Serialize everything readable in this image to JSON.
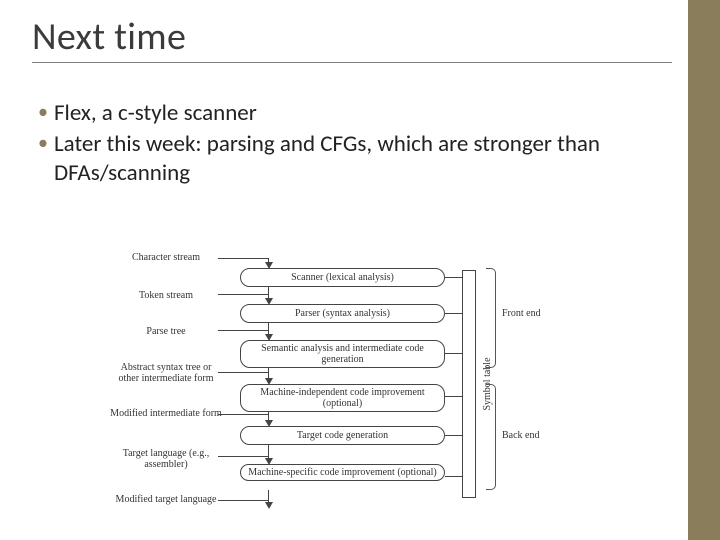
{
  "title": "Next time",
  "bullets": [
    "Flex, a c-style scanner",
    "Later this week: parsing and CFGs, which are stronger than DFAs/scanning"
  ],
  "diagram": {
    "left_labels": [
      "Character stream",
      "Token stream",
      "Parse tree",
      "Abstract syntax tree or other intermediate form",
      "Modified intermediate form",
      "Target language (e.g., assembler)",
      "Modified target language"
    ],
    "stages": [
      "Scanner (lexical analysis)",
      "Parser (syntax analysis)",
      "Semantic analysis and intermediate code generation",
      "Machine-independent code improvement (optional)",
      "Target code generation",
      "Machine-specific code improvement (optional)"
    ],
    "symbol_table": "Symbol table",
    "right_groups": [
      "Front end",
      "Back end"
    ]
  }
}
